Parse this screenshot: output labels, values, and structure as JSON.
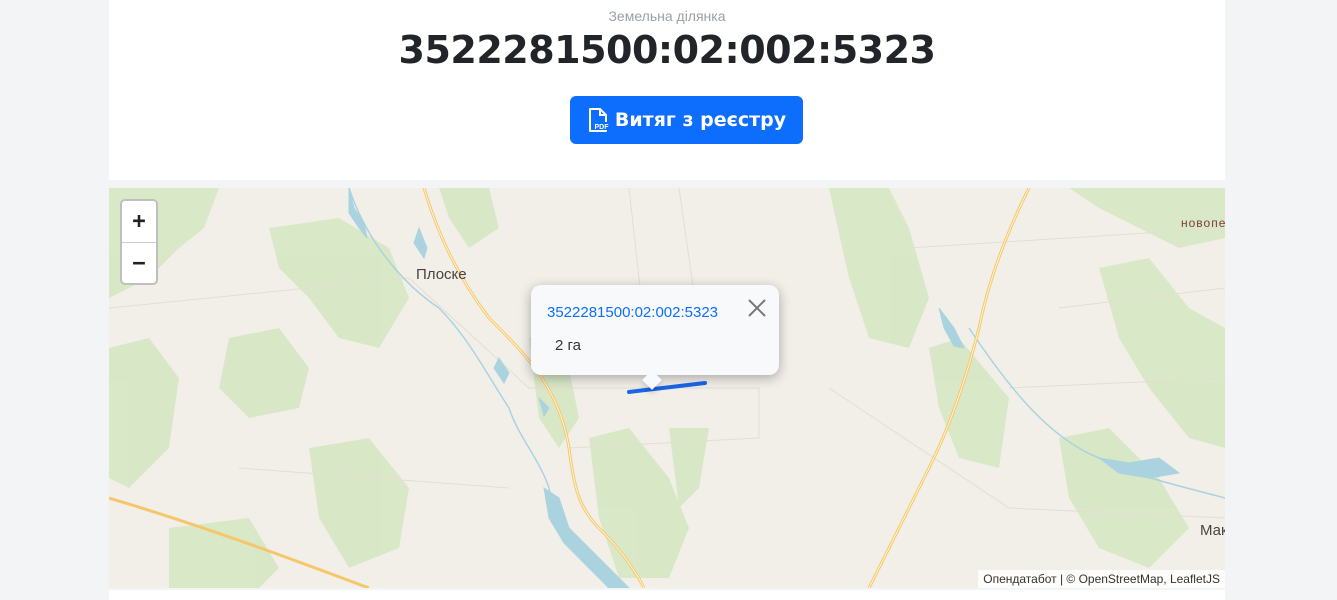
{
  "header": {
    "subtitle": "Земельна ділянка",
    "cadastral_number": "3522281500:02:002:5323"
  },
  "actions": {
    "extract_button_label": "Витяг з реєстру",
    "extract_button_icon": "pdf-file-icon"
  },
  "map": {
    "zoom_in_label": "+",
    "zoom_out_label": "−",
    "places": {
      "plosk": "Плоске",
      "novope": "новопе",
      "mak": "Мак"
    },
    "popup": {
      "link_text": "3522281500:02:002:5323",
      "area_text": "2 га",
      "close_icon": "close-icon"
    },
    "attribution": "Опендатабот | © OpenStreetMap, LeafletJS",
    "colors": {
      "land": "#f2efe9",
      "forest": "#c8dfb0",
      "water": "#aad3df",
      "road": "#f5c76a",
      "parcel": "#1a66e8"
    }
  }
}
